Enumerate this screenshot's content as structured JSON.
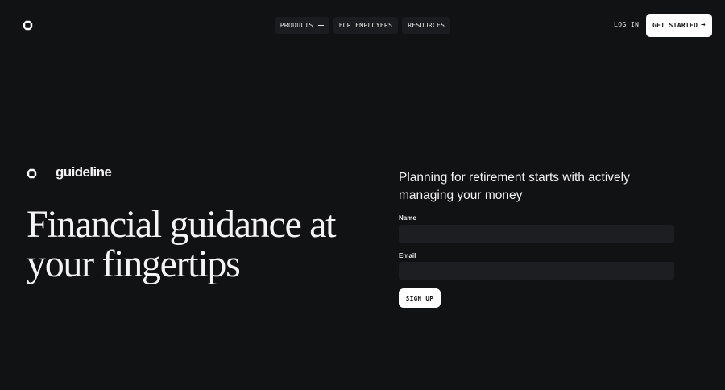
{
  "header": {
    "logo_icon": "octagon-ring-icon",
    "nav": [
      {
        "label": "PRODUCTS",
        "icon": "plus-icon"
      },
      {
        "label": "FOR EMPLOYERS"
      },
      {
        "label": "RESOURCES"
      }
    ],
    "login_label": "LOG IN",
    "cta_label": "GET STARTED",
    "cta_icon": "arrow-right-icon"
  },
  "hero": {
    "brand_name": "guideline",
    "brand_icon": "octagon-ring-icon",
    "headline": "Financial guidance at your fingertips"
  },
  "form": {
    "tagline": "Planning for retirement starts with actively managing your money",
    "name_label": "Name",
    "name_value": "",
    "email_label": "Email",
    "email_value": "",
    "submit_label": "SIGN UP"
  },
  "colors": {
    "background": "#111214",
    "input_background": "#1d1e21",
    "nav_pill": "#1b1c1f",
    "button": "#ffffff"
  }
}
